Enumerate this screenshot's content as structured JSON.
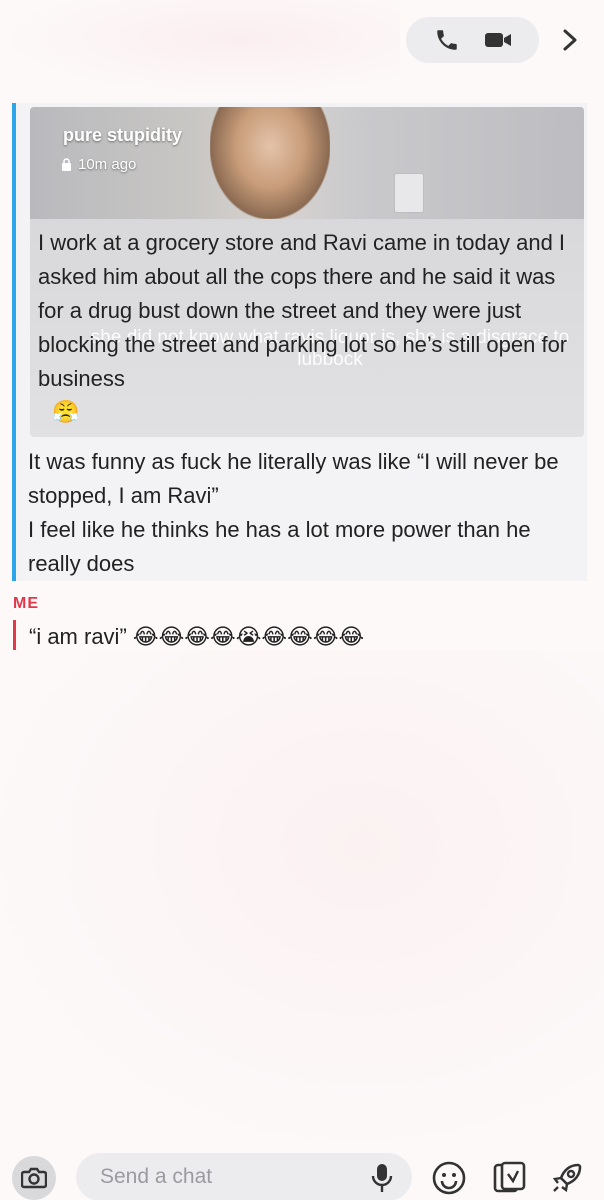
{
  "header": {
    "call_icon": "phone-icon",
    "video_icon": "video-camera-icon",
    "next_icon": "chevron-right-icon"
  },
  "partner": {
    "accent_color": "#2ba6e8",
    "story": {
      "title": "pure stupidity",
      "time": "10m ago",
      "text": "I work at a grocery store and Ravi came in today and I asked him about all the cops there and he said it was for a drug bust down the street and they were just blocking the street and parking lot so he’s still open for business",
      "emoji": "😤",
      "overlay_caption": "she did not know what ravis liquor is, she is a disgrace to lubbock"
    },
    "message": "It was funny as fuck he literally was like “I will never be stopped, I am Ravi”\nI feel like he thinks he has a lot more power than he really does"
  },
  "me": {
    "label": "ME",
    "accent_color": "#e0394a",
    "message": "“i am ravi” 😂😂😂😂😭😂😂😂😂"
  },
  "composer": {
    "placeholder": "Send a chat",
    "camera_icon": "camera-icon",
    "mic_icon": "microphone-icon",
    "emoji_icon": "smiley-icon",
    "sticker_icon": "sticker-icon",
    "rocket_icon": "rocket-icon"
  }
}
